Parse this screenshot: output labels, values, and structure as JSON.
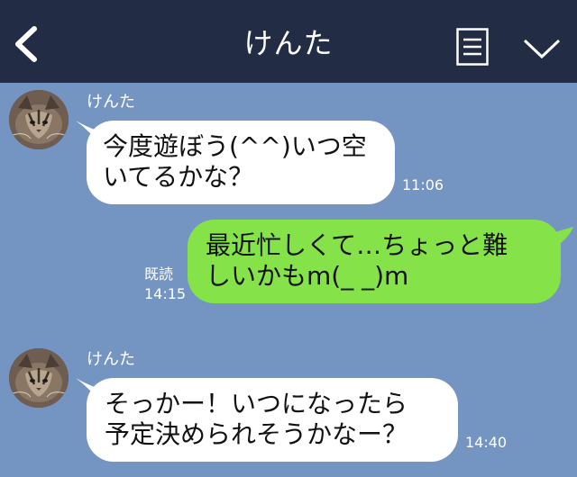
{
  "header": {
    "title": "けんた",
    "back_icon": "chevron-left-icon",
    "menu_icon": "document-lines-icon",
    "collapse_icon": "chevron-down-icon",
    "background_color": "#222c44"
  },
  "chat": {
    "background_color": "#7494c2",
    "incoming_bubble_color": "#ffffff",
    "outgoing_bubble_color": "#85e249",
    "messages": [
      {
        "direction": "incoming",
        "sender": "けんた",
        "text": "今度遊ぼう(^^)いつ空\nいてるかな？",
        "time": "11:06"
      },
      {
        "direction": "outgoing",
        "read_label": "既読",
        "text": "最近忙しくて…ちょっと難\nしいかもm(_ _)m",
        "time": "14:15"
      },
      {
        "direction": "incoming",
        "sender": "けんた",
        "text": "そっかー！いつになったら\n予定決められそうかなー？",
        "time": "14:40"
      }
    ]
  }
}
